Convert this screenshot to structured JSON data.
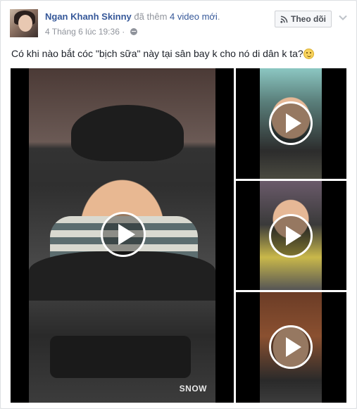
{
  "post": {
    "author_name": "Ngan Khanh Skinny",
    "action_prefix": "đã thêm",
    "action_link": "4 video mới",
    "action_suffix": ".",
    "timestamp": "4 Tháng 6 lúc 19:36",
    "meta_separator": "·",
    "follow_label": "Theo dõi",
    "text": "Có khi nào bắt cóc \"bịch sữa\" này tại sân bay k cho nó di dân k ta?"
  },
  "videos": [
    {
      "watermark": "SNOW"
    },
    {
      "watermark": ""
    },
    {
      "watermark": ""
    },
    {
      "watermark": ""
    }
  ],
  "icons": {
    "privacy": "globe-icon",
    "follow": "rss-icon",
    "options": "chevron-down-icon",
    "emoji": "smiley-emoji-icon",
    "play": "play-icon"
  },
  "colors": {
    "link": "#365899",
    "muted": "#90949c",
    "text": "#1d2129",
    "page_bg": "#e9ebee",
    "button_bg": "#f6f7f9"
  }
}
